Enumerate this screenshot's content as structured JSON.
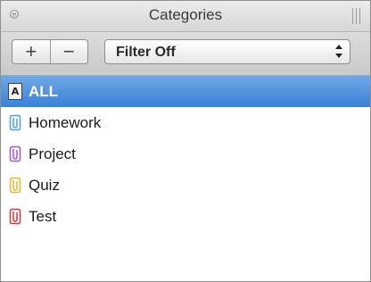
{
  "title": "Categories",
  "toolbar": {
    "add_label": "+",
    "remove_label": "−",
    "filter_value": "Filter Off"
  },
  "categories": [
    {
      "label": "ALL",
      "icon": "all-icon",
      "badge": "A",
      "selected": true
    },
    {
      "label": "Homework",
      "icon": "clip-icon",
      "color": "#4a9fe0"
    },
    {
      "label": "Project",
      "icon": "clip-icon",
      "color": "#a855d6"
    },
    {
      "label": "Quiz",
      "icon": "clip-icon",
      "color": "#e8b52a"
    },
    {
      "label": "Test",
      "icon": "clip-icon",
      "color": "#d9343a"
    }
  ]
}
